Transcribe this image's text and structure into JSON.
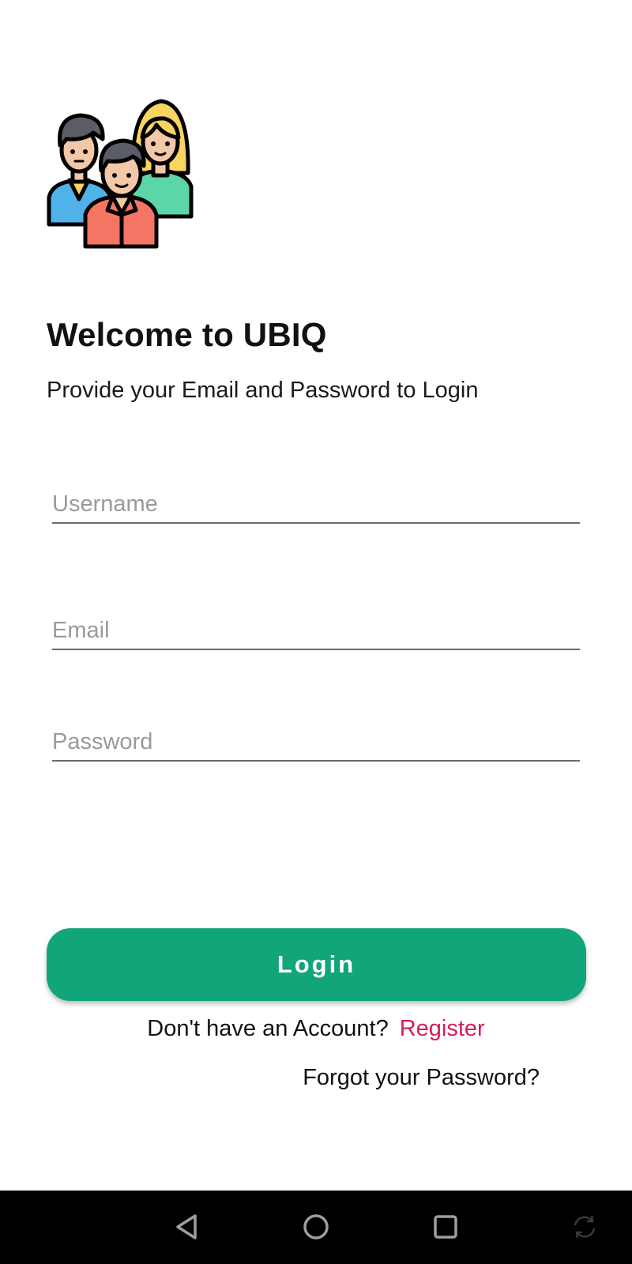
{
  "header": {
    "title": "Welcome to UBIQ",
    "subtitle": "Provide your Email and Password to Login"
  },
  "logo": {
    "icon": "people-group-icon",
    "colors": {
      "outline": "#000000",
      "skin": "#f3c8a8",
      "hair_dark": "#5a5c66",
      "hair_blonde": "#f8d560",
      "shirt_blue": "#4fb3ea",
      "shirt_green": "#5bd6a8",
      "shirt_red": "#f47563",
      "collar": "#f8d560"
    }
  },
  "form": {
    "username": {
      "placeholder": "Username",
      "value": ""
    },
    "email": {
      "placeholder": "Email",
      "value": ""
    },
    "password": {
      "placeholder": "Password",
      "value": ""
    }
  },
  "actions": {
    "login_label": "Login",
    "register_prompt": "Don't have an Account?",
    "register_label": "Register",
    "forgot_label": "Forgot your Password?"
  },
  "theme": {
    "primary": "#12a57a",
    "link": "#d81b60"
  },
  "navbar": {
    "icons": [
      "back-triangle-icon",
      "home-circle-icon",
      "recents-square-icon",
      "rotate-icon"
    ]
  }
}
